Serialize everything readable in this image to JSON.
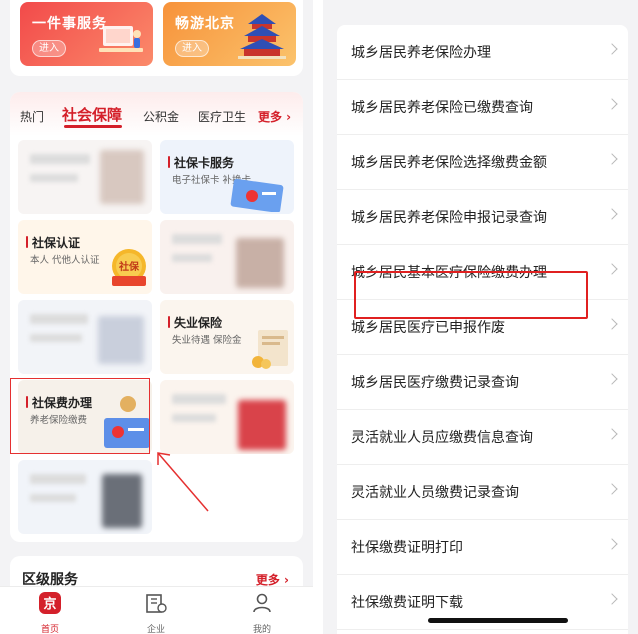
{
  "left": {
    "promos": [
      {
        "title": "一件事服务",
        "button": "进入"
      },
      {
        "title": "畅游北京",
        "button": "进入"
      }
    ],
    "tabs": {
      "hot": "热门",
      "social": "社会保障",
      "fund": "公积金",
      "health": "医疗卫生",
      "more": "更多 ›"
    },
    "tiles": {
      "card": {
        "title": "社保卡服务",
        "subtitle": "电子社保卡 补换卡"
      },
      "auth": {
        "title": "社保认证",
        "subtitle": "本人 代他人认证",
        "badge": "社保"
      },
      "unemployment": {
        "title": "失业保险",
        "subtitle": "失业待遇 保险金"
      },
      "payment": {
        "title": "社保费办理",
        "subtitle": "养老保险缴费"
      }
    },
    "district": {
      "title": "区级服务",
      "more": "更多 ›"
    },
    "nav": [
      {
        "label": "首页",
        "icon_text": "京"
      },
      {
        "label": "企业"
      },
      {
        "label": "我的"
      }
    ]
  },
  "right": {
    "items": [
      "城乡居民养老保险办理",
      "城乡居民养老保险已缴费查询",
      "城乡居民养老保险选择缴费金额",
      "城乡居民养老保险申报记录查询",
      "城乡居民基本医疗保险缴费办理",
      "城乡居民医疗已申报作废",
      "城乡居民医疗缴费记录查询",
      "灵活就业人员应缴费信息查询",
      "灵活就业人员缴费记录查询",
      "社保缴费证明打印",
      "社保缴费证明下载"
    ]
  },
  "colors": {
    "accent": "#d4202a",
    "highlight_box": "#e02020"
  }
}
